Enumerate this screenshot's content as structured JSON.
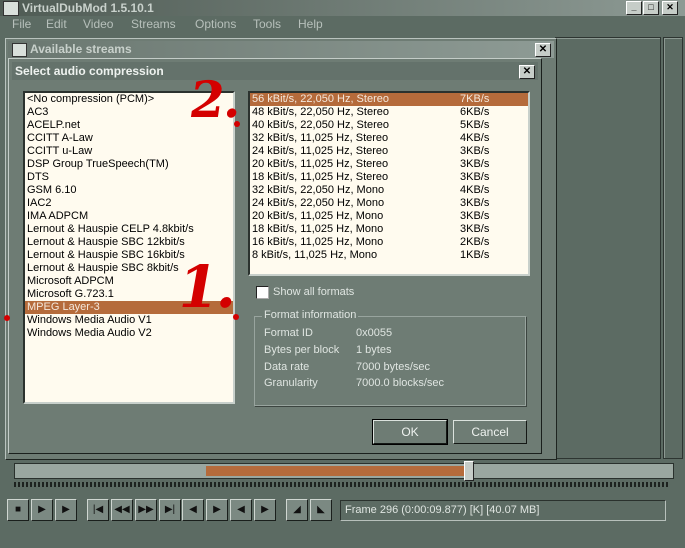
{
  "main_window": {
    "title": "VirtualDubMod 1.5.10.1",
    "menu": [
      "File",
      "Edit",
      "Video",
      "Streams",
      "Options",
      "Tools",
      "Help"
    ]
  },
  "streams_dialog": {
    "title": "Available streams"
  },
  "audio_dialog": {
    "title": "Select audio compression",
    "codecs": [
      "<No compression (PCM)>",
      "AC3",
      "ACELP.net",
      "CCITT A-Law",
      "CCITT u-Law",
      "DSP Group TrueSpeech(TM)",
      "DTS",
      "GSM 6.10",
      "IAC2",
      "IMA ADPCM",
      "Lernout & Hauspie CELP 4.8kbit/s",
      "Lernout & Hauspie SBC 12kbit/s",
      "Lernout & Hauspie SBC 16kbit/s",
      "Lernout & Hauspie SBC 8kbit/s",
      "Microsoft ADPCM",
      "Microsoft G.723.1",
      "MPEG Layer-3",
      "Windows Media Audio V1",
      "Windows Media Audio V2"
    ],
    "selected_codec_index": 16,
    "formats": [
      {
        "desc": "56 kBit/s, 22,050 Hz, Stereo",
        "rate": "7KB/s"
      },
      {
        "desc": "48 kBit/s, 22,050 Hz, Stereo",
        "rate": "6KB/s"
      },
      {
        "desc": "40 kBit/s, 22,050 Hz, Stereo",
        "rate": "5KB/s"
      },
      {
        "desc": "32 kBit/s, 11,025 Hz, Stereo",
        "rate": "4KB/s"
      },
      {
        "desc": "24 kBit/s, 11,025 Hz, Stereo",
        "rate": "3KB/s"
      },
      {
        "desc": "20 kBit/s, 11,025 Hz, Stereo",
        "rate": "3KB/s"
      },
      {
        "desc": "18 kBit/s, 11,025 Hz, Stereo",
        "rate": "3KB/s"
      },
      {
        "desc": "32 kBit/s, 22,050 Hz, Mono",
        "rate": "4KB/s"
      },
      {
        "desc": "24 kBit/s, 22,050 Hz, Mono",
        "rate": "3KB/s"
      },
      {
        "desc": "20 kBit/s, 11,025 Hz, Mono",
        "rate": "3KB/s"
      },
      {
        "desc": "18 kBit/s, 11,025 Hz, Mono",
        "rate": "3KB/s"
      },
      {
        "desc": "16 kBit/s, 11,025 Hz, Mono",
        "rate": "2KB/s"
      },
      {
        "desc": "8 kBit/s, 11,025 Hz, Mono",
        "rate": "1KB/s"
      }
    ],
    "selected_format_index": 0,
    "show_all_formats_label": "Show all formats",
    "show_all_formats_checked": false,
    "format_info": {
      "title": "Format information",
      "rows": [
        {
          "label": "Format ID",
          "value": "0x0055"
        },
        {
          "label": "Bytes per block",
          "value": "1 bytes"
        },
        {
          "label": "Data rate",
          "value": "7000 bytes/sec"
        },
        {
          "label": "Granularity",
          "value": "7000.0 blocks/sec"
        }
      ]
    },
    "ok_label": "OK",
    "cancel_label": "Cancel"
  },
  "annotations": {
    "marker_1": "1.",
    "marker_2": "2."
  },
  "timeline": {
    "selection_start_fraction": 0.29,
    "selection_end_fraction": 0.69,
    "position_fraction": 0.69
  },
  "status": {
    "frame_text": "Frame 296 (0:00:09.877) [K] [40.07 MB]"
  },
  "colors": {
    "selection": "#b56b3b",
    "annotation": "#d40000",
    "dialog_bg": "#6e7c74"
  }
}
